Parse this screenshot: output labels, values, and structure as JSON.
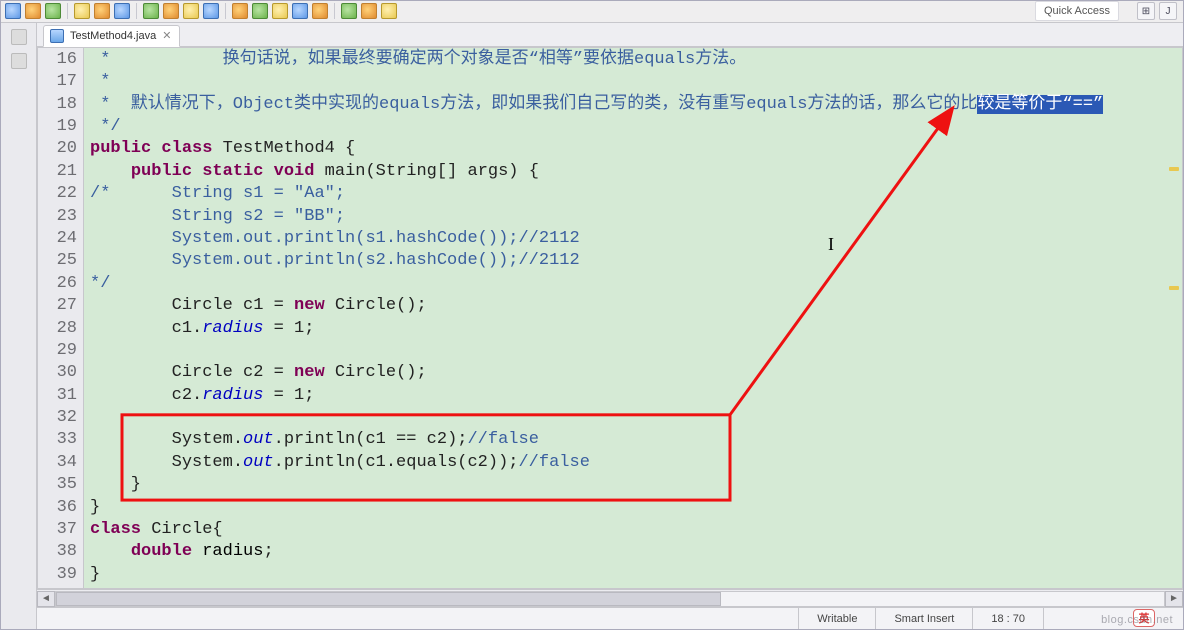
{
  "window": {
    "quick_access": "Quick Access"
  },
  "tabs": [
    {
      "label": "TestMethod4.java"
    }
  ],
  "code": {
    "lines": [
      {
        "num": 16,
        "parts": [
          {
            "t": " *           ",
            "c": "c-com"
          },
          {
            "t": "换句话说，如果最终要确定两个对象是否“相等”要依据equals方法。",
            "c": "c-com"
          }
        ]
      },
      {
        "num": 17,
        "parts": [
          {
            "t": " *",
            "c": "c-com"
          }
        ]
      },
      {
        "num": 18,
        "parts": [
          {
            "t": " *  默认情况下，Object类中实现的equals方法，即如果我们自己写的类，没有重写equals方法的话，那么它的比",
            "c": "c-com"
          },
          {
            "t": "较是等价于“==”",
            "c": "c-slc"
          }
        ]
      },
      {
        "num": 19,
        "parts": [
          {
            "t": " */",
            "c": "c-com"
          }
        ]
      },
      {
        "num": 20,
        "parts": [
          {
            "t": "public",
            "c": "c-kw"
          },
          {
            "t": " "
          },
          {
            "t": "class",
            "c": "c-kw"
          },
          {
            "t": " TestMethod4 {"
          }
        ]
      },
      {
        "num": 21,
        "parts": [
          {
            "t": "    "
          },
          {
            "t": "public",
            "c": "c-kw"
          },
          {
            "t": " "
          },
          {
            "t": "static",
            "c": "c-kw"
          },
          {
            "t": " "
          },
          {
            "t": "void",
            "c": "c-kw"
          },
          {
            "t": " main(String[] args) {"
          }
        ]
      },
      {
        "num": 22,
        "parts": [
          {
            "t": "/*      String s1 = ",
            "c": "c-com"
          },
          {
            "t": "\"Aa\"",
            "c": "c-com"
          },
          {
            "t": ";",
            "c": "c-com"
          }
        ]
      },
      {
        "num": 23,
        "parts": [
          {
            "t": "        String s2 = \"BB\";",
            "c": "c-com"
          }
        ]
      },
      {
        "num": 24,
        "parts": [
          {
            "t": "        System.out.println(s1.hashCode());//2112",
            "c": "c-com"
          }
        ]
      },
      {
        "num": 25,
        "parts": [
          {
            "t": "        System.out.println(s2.hashCode());//2112",
            "c": "c-com"
          }
        ]
      },
      {
        "num": 26,
        "parts": [
          {
            "t": "*/",
            "c": "c-com"
          }
        ]
      },
      {
        "num": 27,
        "parts": [
          {
            "t": "        Circle c1 = "
          },
          {
            "t": "new",
            "c": "c-kw"
          },
          {
            "t": " Circle();"
          }
        ]
      },
      {
        "num": 28,
        "parts": [
          {
            "t": "        c1."
          },
          {
            "t": "radius",
            "c": "c-fld"
          },
          {
            "t": " = 1;"
          }
        ]
      },
      {
        "num": 29,
        "parts": [
          {
            "t": " "
          }
        ]
      },
      {
        "num": 30,
        "parts": [
          {
            "t": "        Circle c2 = "
          },
          {
            "t": "new",
            "c": "c-kw"
          },
          {
            "t": " Circle();"
          }
        ]
      },
      {
        "num": 31,
        "parts": [
          {
            "t": "        c2."
          },
          {
            "t": "radius",
            "c": "c-fld"
          },
          {
            "t": " = 1;"
          }
        ]
      },
      {
        "num": 32,
        "parts": [
          {
            "t": " "
          }
        ]
      },
      {
        "num": 33,
        "parts": [
          {
            "t": "        System."
          },
          {
            "t": "out",
            "c": "c-fld"
          },
          {
            "t": ".println(c1 == c2);"
          },
          {
            "t": "//false",
            "c": "c-com"
          }
        ]
      },
      {
        "num": 34,
        "parts": [
          {
            "t": "        System."
          },
          {
            "t": "out",
            "c": "c-fld"
          },
          {
            "t": ".println(c1.equals(c2));"
          },
          {
            "t": "//false",
            "c": "c-com"
          }
        ]
      },
      {
        "num": 35,
        "parts": [
          {
            "t": "    }"
          }
        ]
      },
      {
        "num": 36,
        "parts": [
          {
            "t": "}"
          }
        ]
      },
      {
        "num": 37,
        "parts": [
          {
            "t": "class",
            "c": "c-kw"
          },
          {
            "t": " Circle{"
          }
        ]
      },
      {
        "num": 38,
        "parts": [
          {
            "t": "    "
          },
          {
            "t": "double",
            "c": "c-kw"
          },
          {
            "t": " "
          },
          {
            "t": "radius",
            "c": "c-id"
          },
          {
            "t": ";"
          }
        ]
      },
      {
        "num": 39,
        "parts": [
          {
            "t": "}"
          }
        ]
      }
    ]
  },
  "status": {
    "writable": "Writable",
    "mode": "Smart Insert",
    "pos": "18 : 70"
  },
  "ime": "英",
  "watermark": "blog.csdn.net",
  "perspective_labels": {
    "open": "⊞",
    "java": "J"
  }
}
